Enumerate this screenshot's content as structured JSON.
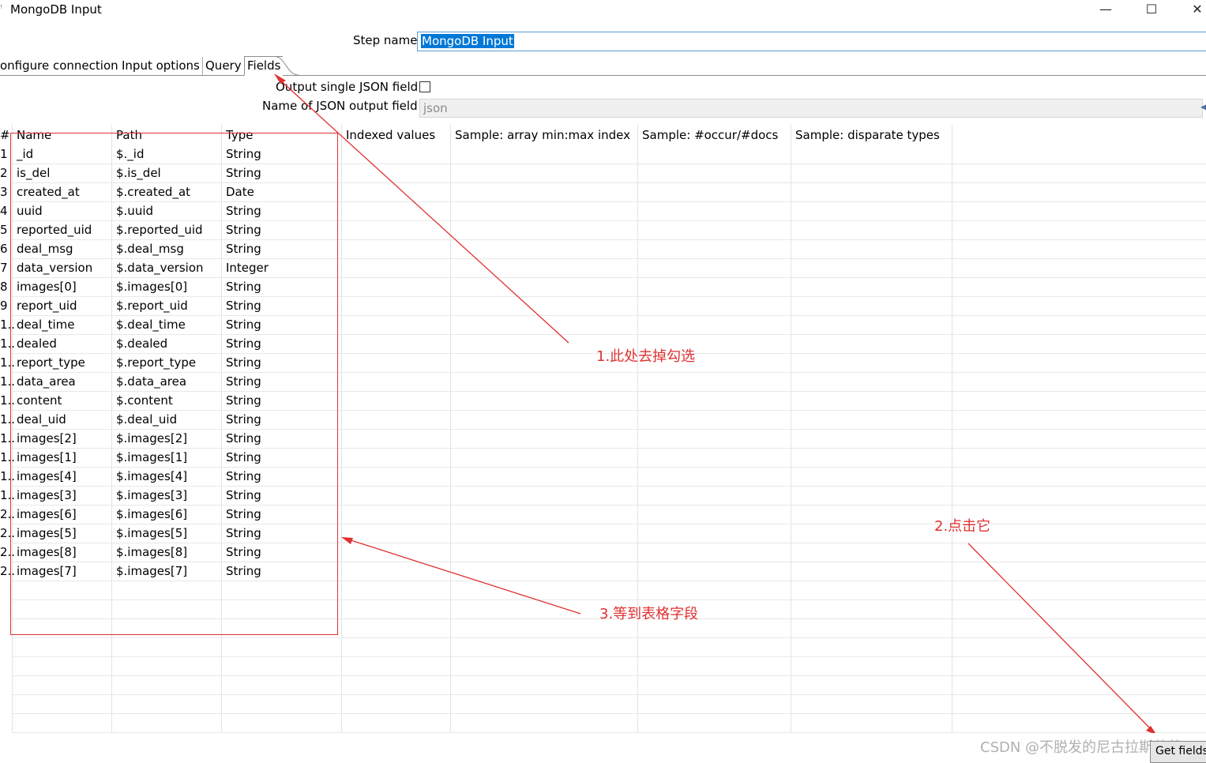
{
  "window": {
    "title": "MongoDB Input",
    "minimize_glyph": "—",
    "maximize_glyph": "☐",
    "close_glyph": "✕"
  },
  "step": {
    "label": "Step name",
    "value": "MongoDB Input"
  },
  "tabs": [
    {
      "label": "onfigure connection"
    },
    {
      "label": "Input options"
    },
    {
      "label": "Query"
    },
    {
      "label": "Fields"
    }
  ],
  "fields_tab": {
    "output_single_json_label": "Output single JSON field",
    "output_single_json_checked": false,
    "json_output_name_label": "Name of JSON output field",
    "json_output_name_value": "json"
  },
  "grid": {
    "columns": [
      "#",
      "Name",
      "Path",
      "Type",
      "Indexed values",
      "Sample: array min:max index",
      "Sample: #occur/#docs",
      "Sample: disparate types"
    ],
    "rows": [
      {
        "num": "1",
        "name": "_id",
        "path": "$._id",
        "type": "String"
      },
      {
        "num": "2",
        "name": "is_del",
        "path": "$.is_del",
        "type": "String"
      },
      {
        "num": "3",
        "name": "created_at",
        "path": "$.created_at",
        "type": "Date"
      },
      {
        "num": "4",
        "name": "uuid",
        "path": "$.uuid",
        "type": "String"
      },
      {
        "num": "5",
        "name": "reported_uid",
        "path": "$.reported_uid",
        "type": "String"
      },
      {
        "num": "6",
        "name": "deal_msg",
        "path": "$.deal_msg",
        "type": "String"
      },
      {
        "num": "7",
        "name": "data_version",
        "path": "$.data_version",
        "type": "Integer"
      },
      {
        "num": "8",
        "name": "images[0]",
        "path": "$.images[0]",
        "type": "String"
      },
      {
        "num": "9",
        "name": "report_uid",
        "path": "$.report_uid",
        "type": "String"
      },
      {
        "num": "1..",
        "name": "deal_time",
        "path": "$.deal_time",
        "type": "String"
      },
      {
        "num": "1..",
        "name": "dealed",
        "path": "$.dealed",
        "type": "String"
      },
      {
        "num": "1..",
        "name": "report_type",
        "path": "$.report_type",
        "type": "String"
      },
      {
        "num": "1..",
        "name": "data_area",
        "path": "$.data_area",
        "type": "String"
      },
      {
        "num": "1..",
        "name": "content",
        "path": "$.content",
        "type": "String"
      },
      {
        "num": "1..",
        "name": "deal_uid",
        "path": "$.deal_uid",
        "type": "String"
      },
      {
        "num": "1..",
        "name": "images[2]",
        "path": "$.images[2]",
        "type": "String"
      },
      {
        "num": "1..",
        "name": "images[1]",
        "path": "$.images[1]",
        "type": "String"
      },
      {
        "num": "1..",
        "name": "images[4]",
        "path": "$.images[4]",
        "type": "String"
      },
      {
        "num": "1..",
        "name": "images[3]",
        "path": "$.images[3]",
        "type": "String"
      },
      {
        "num": "2..",
        "name": "images[6]",
        "path": "$.images[6]",
        "type": "String"
      },
      {
        "num": "2..",
        "name": "images[5]",
        "path": "$.images[5]",
        "type": "String"
      },
      {
        "num": "2..",
        "name": "images[8]",
        "path": "$.images[8]",
        "type": "String"
      },
      {
        "num": "2..",
        "name": "images[7]",
        "path": "$.images[7]",
        "type": "String"
      }
    ]
  },
  "annotations": {
    "a1": "1.此处去掉勾选",
    "a2": "2.点击它",
    "a3": "3.等到表格字段",
    "color": "#e03131"
  },
  "buttons": {
    "get_fields": "Get fields"
  },
  "watermark": "CSDN @不脱发的尼古拉斯萧萧"
}
